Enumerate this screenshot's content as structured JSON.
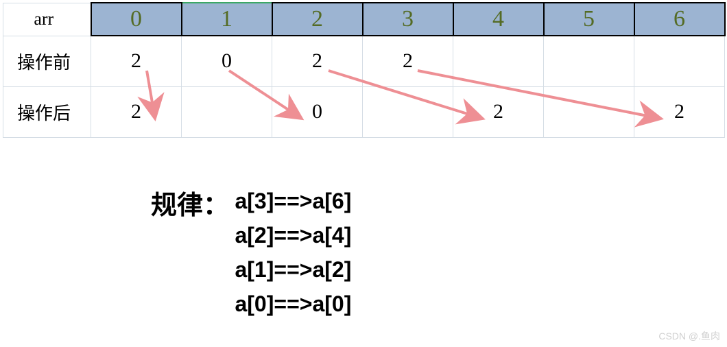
{
  "labels": {
    "arr": "arr",
    "before": "操作前",
    "after": "操作后"
  },
  "indices": [
    "0",
    "1",
    "2",
    "3",
    "4",
    "5",
    "6"
  ],
  "before_row": [
    "2",
    "0",
    "2",
    "2",
    "",
    "",
    ""
  ],
  "after_row": [
    "2",
    "",
    "0",
    "",
    "2",
    "",
    "2"
  ],
  "rules_title": "规律：",
  "rules": [
    "a[3]==>a[6]",
    "a[2]==>a[4]",
    "a[1]==>a[2]",
    "a[0]==>a[0]"
  ],
  "chart_data": {
    "type": "table",
    "title": "Array index shift mapping",
    "columns": [
      "0",
      "1",
      "2",
      "3",
      "4",
      "5",
      "6"
    ],
    "series": [
      {
        "name": "操作前",
        "values": [
          2,
          0,
          2,
          2,
          null,
          null,
          null
        ]
      },
      {
        "name": "操作后",
        "values": [
          2,
          null,
          0,
          null,
          2,
          null,
          2
        ]
      }
    ],
    "arrows": [
      {
        "from_col": 0,
        "to_col": 0
      },
      {
        "from_col": 1,
        "to_col": 2
      },
      {
        "from_col": 2,
        "to_col": 4
      },
      {
        "from_col": 3,
        "to_col": 6
      }
    ],
    "rules": [
      "a[3]==>a[6]",
      "a[2]==>a[4]",
      "a[1]==>a[2]",
      "a[0]==>a[0]"
    ]
  },
  "watermark": "CSDN @.鱼肉"
}
